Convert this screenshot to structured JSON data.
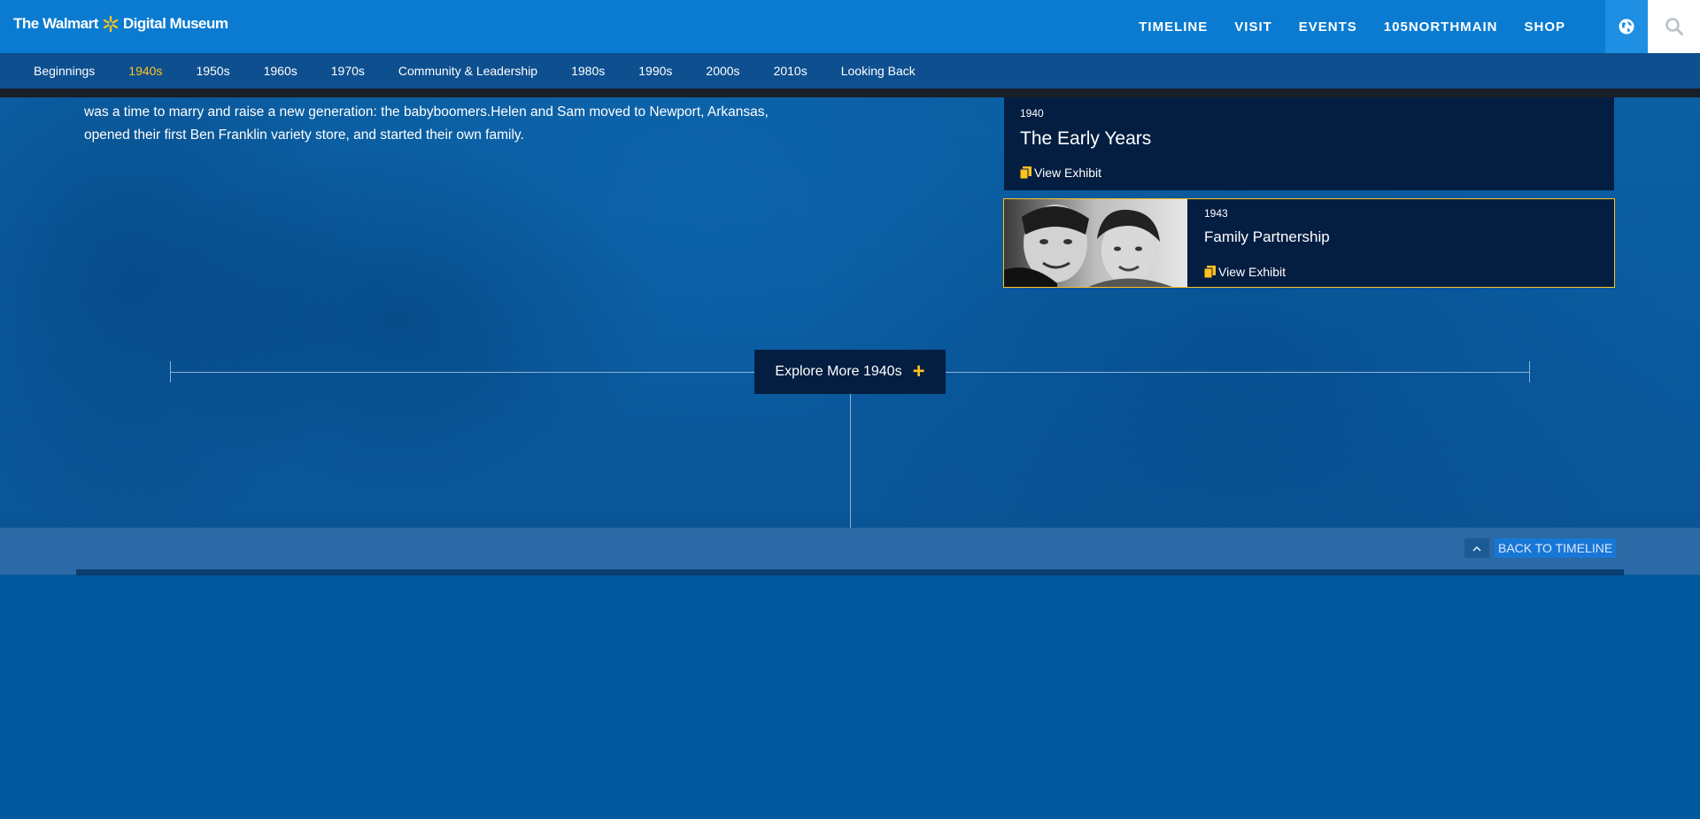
{
  "header": {
    "logo_text": "The Walmart",
    "logo_suffix": "Digital Museum",
    "nav": [
      "TIMELINE",
      "VISIT",
      "EVENTS",
      "105NORTHMAIN",
      "SHOP"
    ],
    "globe_icon": "globe-icon",
    "search_icon": "search-icon"
  },
  "subnav": {
    "items": [
      "Beginnings",
      "1940s",
      "1950s",
      "1960s",
      "1970s",
      "Community & Leadership",
      "1980s",
      "1990s",
      "2000s",
      "2010s",
      "Looking Back"
    ],
    "active": "1940s"
  },
  "hero": {
    "text_line1": "was a time to marry and raise a new generation: the babyboomers.Helen and Sam moved to Newport, Arkansas,",
    "text_line2": "opened their first Ben Franklin variety store, and started their own family."
  },
  "exhibits": [
    {
      "year": "1940",
      "title": "The Early Years",
      "link": "View Exhibit"
    },
    {
      "year": "1943",
      "title": "Family Partnership",
      "link": "View Exhibit"
    }
  ],
  "explore": {
    "label": "Explore More 1940s",
    "icon": "plus-icon"
  },
  "back": {
    "label": "BACK TO TIMELINE",
    "icon": "chevron-up-icon"
  },
  "colors": {
    "accent": "#ffc220",
    "header": "#0a7bd0",
    "card": "#041e42"
  }
}
